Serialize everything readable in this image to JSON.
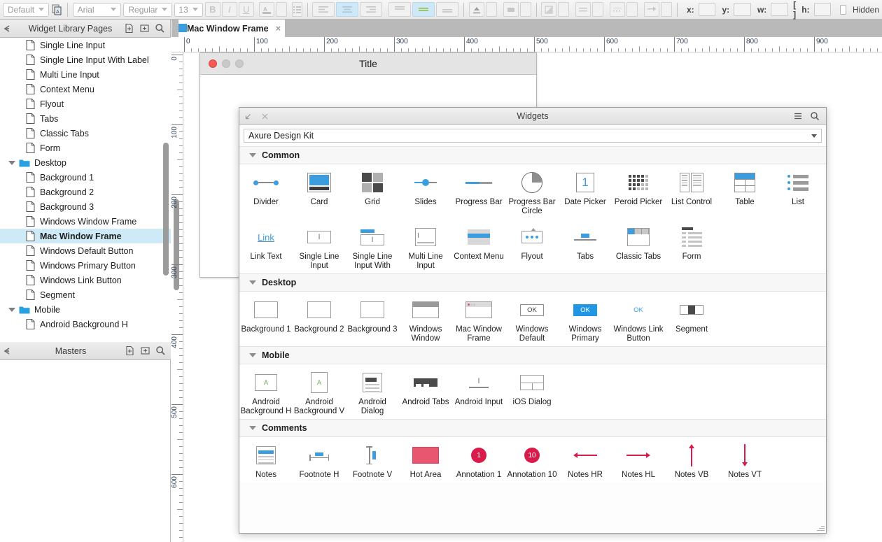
{
  "toolbar": {
    "style_select": "Default",
    "font_select": "Arial",
    "weight_select": "Regular",
    "size_select": "13",
    "bold": "B",
    "italic": "I",
    "underline": "U",
    "x_label": "x:",
    "y_label": "y:",
    "w_label": "w:",
    "h_label": "h:",
    "lock_label": "[ ]",
    "x_value": "",
    "y_value": "",
    "w_value": "",
    "h_value": "",
    "hidden_label": "Hidden"
  },
  "sidebar": {
    "pages_panel": {
      "title": "Widget Library Pages",
      "items": [
        {
          "label": "Single Line Input",
          "type": "page",
          "indent": 1,
          "selected": false
        },
        {
          "label": "Single Line Input With Label",
          "type": "page",
          "indent": 1,
          "selected": false
        },
        {
          "label": "Multi Line Input",
          "type": "page",
          "indent": 1,
          "selected": false
        },
        {
          "label": "Context Menu",
          "type": "page",
          "indent": 1,
          "selected": false
        },
        {
          "label": "Flyout",
          "type": "page",
          "indent": 1,
          "selected": false
        },
        {
          "label": "Tabs",
          "type": "page",
          "indent": 1,
          "selected": false
        },
        {
          "label": "Classic Tabs",
          "type": "page",
          "indent": 1,
          "selected": false
        },
        {
          "label": "Form",
          "type": "page",
          "indent": 1,
          "selected": false
        },
        {
          "label": "Desktop",
          "type": "folder",
          "indent": 0,
          "selected": false
        },
        {
          "label": "Background 1",
          "type": "page",
          "indent": 1,
          "selected": false
        },
        {
          "label": "Background 2",
          "type": "page",
          "indent": 1,
          "selected": false
        },
        {
          "label": "Background 3",
          "type": "page",
          "indent": 1,
          "selected": false
        },
        {
          "label": "Windows Window Frame",
          "type": "page",
          "indent": 1,
          "selected": false
        },
        {
          "label": "Mac Window Frame",
          "type": "page",
          "indent": 1,
          "selected": true
        },
        {
          "label": "Windows Default Button",
          "type": "page",
          "indent": 1,
          "selected": false
        },
        {
          "label": "Windows Primary Button",
          "type": "page",
          "indent": 1,
          "selected": false
        },
        {
          "label": "Windows Link Button",
          "type": "page",
          "indent": 1,
          "selected": false
        },
        {
          "label": "Segment",
          "type": "page",
          "indent": 1,
          "selected": false
        },
        {
          "label": "Mobile",
          "type": "folder",
          "indent": 0,
          "selected": false
        },
        {
          "label": "Android Background H",
          "type": "page",
          "indent": 1,
          "selected": false
        }
      ]
    },
    "masters_panel": {
      "title": "Masters"
    }
  },
  "canvas": {
    "tab_label": "Mac Window Frame",
    "tab_close": "×",
    "h_ruler_labels": [
      "0",
      "100",
      "200",
      "300",
      "400",
      "500",
      "600",
      "700",
      "800",
      "900"
    ],
    "v_ruler_labels": [
      "0",
      "100",
      "200",
      "300",
      "400",
      "500",
      "600"
    ],
    "mac_window": {
      "title": "Title"
    }
  },
  "widgets_panel": {
    "title": "Widgets",
    "library": "Axure Design Kit",
    "icons": {
      "collapse": "collapse-icon",
      "close": "close-icon",
      "menu": "hamburger-icon",
      "search": "search-icon"
    },
    "sections": [
      {
        "name": "Common",
        "rows": [
          [
            {
              "label": "Divider",
              "icon": "divider"
            },
            {
              "label": "Card",
              "icon": "card"
            },
            {
              "label": "Grid",
              "icon": "grid"
            },
            {
              "label": "Slides",
              "icon": "slides"
            },
            {
              "label": "Progress Bar",
              "icon": "pbar"
            },
            {
              "label": "Progress Bar Circle",
              "icon": "pcircle"
            },
            {
              "label": "Date Picker",
              "icon": "date",
              "glyph": "1"
            },
            {
              "label": "Peroid Picker",
              "icon": "period"
            },
            {
              "label": "List Control",
              "icon": "listctrl"
            },
            {
              "label": "Table",
              "icon": "table"
            },
            {
              "label": "List",
              "icon": "list"
            }
          ],
          [
            {
              "label": "Link Text",
              "icon": "linktext",
              "glyph": "Link"
            },
            {
              "label": "Single Line Input",
              "icon": "sli",
              "glyph": "I"
            },
            {
              "label": "Single Line Input With",
              "icon": "sliwl",
              "glyph": "I"
            },
            {
              "label": "Multi Line Input",
              "icon": "mli",
              "glyph": "I"
            },
            {
              "label": "Context Menu",
              "icon": "ctxmenu"
            },
            {
              "label": "Flyout",
              "icon": "flyout"
            },
            {
              "label": "Tabs",
              "icon": "tabs"
            },
            {
              "label": "Classic Tabs",
              "icon": "ctabs"
            },
            {
              "label": "Form",
              "icon": "form"
            }
          ]
        ]
      },
      {
        "name": "Desktop",
        "rows": [
          [
            {
              "label": "Background 1",
              "icon": "bg"
            },
            {
              "label": "Background 2",
              "icon": "bg"
            },
            {
              "label": "Background 3",
              "icon": "bg"
            },
            {
              "label": "Windows Window",
              "icon": "winwin"
            },
            {
              "label": "Mac Window Frame",
              "icon": "macwin"
            },
            {
              "label": "Windows Default",
              "icon": "btn",
              "glyph": "OK"
            },
            {
              "label": "Windows Primary",
              "icon": "btnprim",
              "glyph": "OK"
            },
            {
              "label": "Windows Link Button",
              "icon": "btnlink",
              "glyph": "OK"
            },
            {
              "label": "Segment",
              "icon": "segment"
            }
          ]
        ]
      },
      {
        "name": "Mobile",
        "rows": [
          [
            {
              "label": "Android Background H",
              "icon": "andbgh",
              "glyph": "A"
            },
            {
              "label": "Android Background V",
              "icon": "andbgv",
              "glyph": "A"
            },
            {
              "label": "Android Dialog",
              "icon": "anddlg"
            },
            {
              "label": "Android Tabs",
              "icon": "andtabs"
            },
            {
              "label": "Android Input",
              "icon": "andinput",
              "glyph": "I"
            },
            {
              "label": "iOS Dialog",
              "icon": "iosdlg"
            }
          ]
        ]
      },
      {
        "name": "Comments",
        "rows": [
          [
            {
              "label": "Notes",
              "icon": "notes"
            },
            {
              "label": "Footnote H",
              "icon": "fnh"
            },
            {
              "label": "Footnote V",
              "icon": "fnv"
            },
            {
              "label": "Hot Area",
              "icon": "hotarea"
            },
            {
              "label": "Annotation 1",
              "icon": "annot",
              "glyph": "1"
            },
            {
              "label": "Annotation 10",
              "icon": "annot",
              "glyph": "10"
            },
            {
              "label": "Notes HR",
              "icon": "arrowleft"
            },
            {
              "label": "Notes HL",
              "icon": "arrowright"
            },
            {
              "label": "Notes VB",
              "icon": "arrowup"
            },
            {
              "label": "Notes VT",
              "icon": "arrowdown"
            }
          ]
        ]
      }
    ]
  },
  "colors": {
    "accent_blue": "#3b9ddd",
    "selection_blue": "#cfeaf7",
    "annotation_red": "#d81b4a",
    "hot_area_pink": "#e8576f",
    "mac_close_red": "#f45b52"
  }
}
